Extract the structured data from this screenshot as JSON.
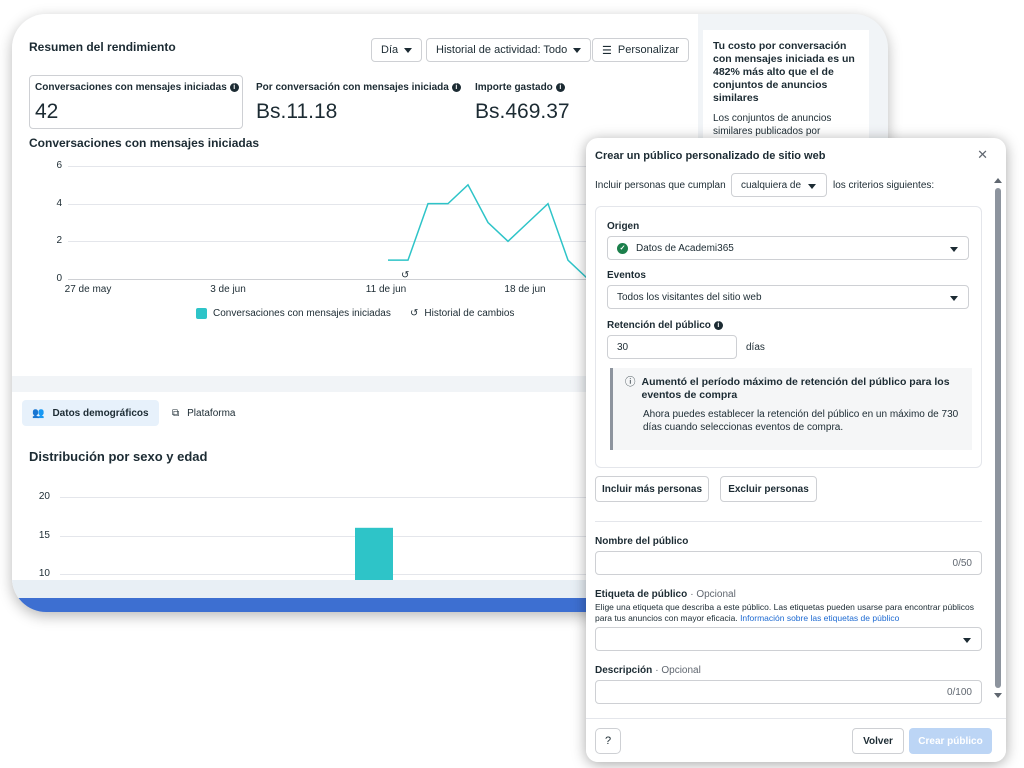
{
  "summary": {
    "title": "Resumen del rendimiento",
    "period_label": "Día",
    "history_label": "Historial de actividad: Todo",
    "customize_label": "Personalizar"
  },
  "metrics": [
    {
      "label": "Conversaciones con mensajes iniciadas",
      "value": "42"
    },
    {
      "label": "Por conversación con mensajes iniciada",
      "value": "Bs.11.18"
    },
    {
      "label": "Importe gastado",
      "value": "Bs.469.37"
    }
  ],
  "insight": {
    "headline": "Tu costo por conversación con mensajes iniciada es un 482% más alto que el de conjuntos de anuncios similares",
    "body": "Los conjuntos de anuncios similares publicados por"
  },
  "chart_data": [
    {
      "type": "line",
      "title": "Conversaciones con mensajes iniciadas",
      "x_ticks": [
        "27 de may",
        "3 de jun",
        "11 de jun",
        "18 de jun"
      ],
      "x_index_of_ticks": [
        0,
        7,
        15,
        22
      ],
      "y_ticks": [
        "0",
        "2",
        "4",
        "6"
      ],
      "ylim": [
        0,
        6
      ],
      "series": [
        {
          "name": "Conversaciones con mensajes iniciadas",
          "color": "#2ec4c8",
          "x": [
            15,
            16,
            17,
            18,
            19,
            20,
            21,
            22,
            23,
            24,
            25
          ],
          "values": [
            1,
            1,
            4,
            4,
            5,
            3,
            2,
            3,
            4,
            1,
            0
          ]
        }
      ],
      "legend": [
        "Conversaciones con mensajes iniciadas",
        "Historial de cambios"
      ],
      "legend_position": "bottom",
      "grid": true
    },
    {
      "type": "bar",
      "title": "Distribución por sexo y edad",
      "y_ticks": [
        "10",
        "15",
        "20"
      ],
      "ylim": [
        8,
        20
      ],
      "values": [
        16
      ],
      "color": "#2ec4c8"
    }
  ],
  "tabs": [
    {
      "label": "Datos demográficos",
      "active": true
    },
    {
      "label": "Plataforma",
      "active": false
    }
  ],
  "modal": {
    "title": "Crear un público personalizado de sitio web",
    "include_prefix": "Incluir personas que cumplan",
    "match_value": "cualquiera de",
    "include_suffix": "los criterios siguientes:",
    "origin_label": "Origen",
    "origin_value": "Datos de Academi365",
    "events_label": "Eventos",
    "events_value": "Todos los visitantes del sitio web",
    "retention_label": "Retención del público",
    "retention_value": "30",
    "retention_unit": "días",
    "notice_title": "Aumentó el período máximo de retención del público para los eventos de compra",
    "notice_body": "Ahora puedes establecer la retención del público en un máximo de 730 días cuando seleccionas eventos de compra.",
    "include_more": "Incluir más personas",
    "exclude": "Excluir personas",
    "name_label": "Nombre del público",
    "name_count": "0/50",
    "tag_label": "Etiqueta de público",
    "optional": "· Opcional",
    "tag_help": "Elige una etiqueta que describa a este público. Las etiquetas pueden usarse para encontrar públicos para tus anuncios con mayor eficacia.",
    "tag_help_link": "Información sobre las etiquetas de público",
    "desc_label": "Descripción",
    "desc_count": "0/100",
    "back_label": "Volver",
    "create_label": "Crear público"
  },
  "colors": {
    "accent": "#2ec4c8",
    "primary_disabled": "#bcd5f5",
    "link": "#1d6ad2"
  }
}
